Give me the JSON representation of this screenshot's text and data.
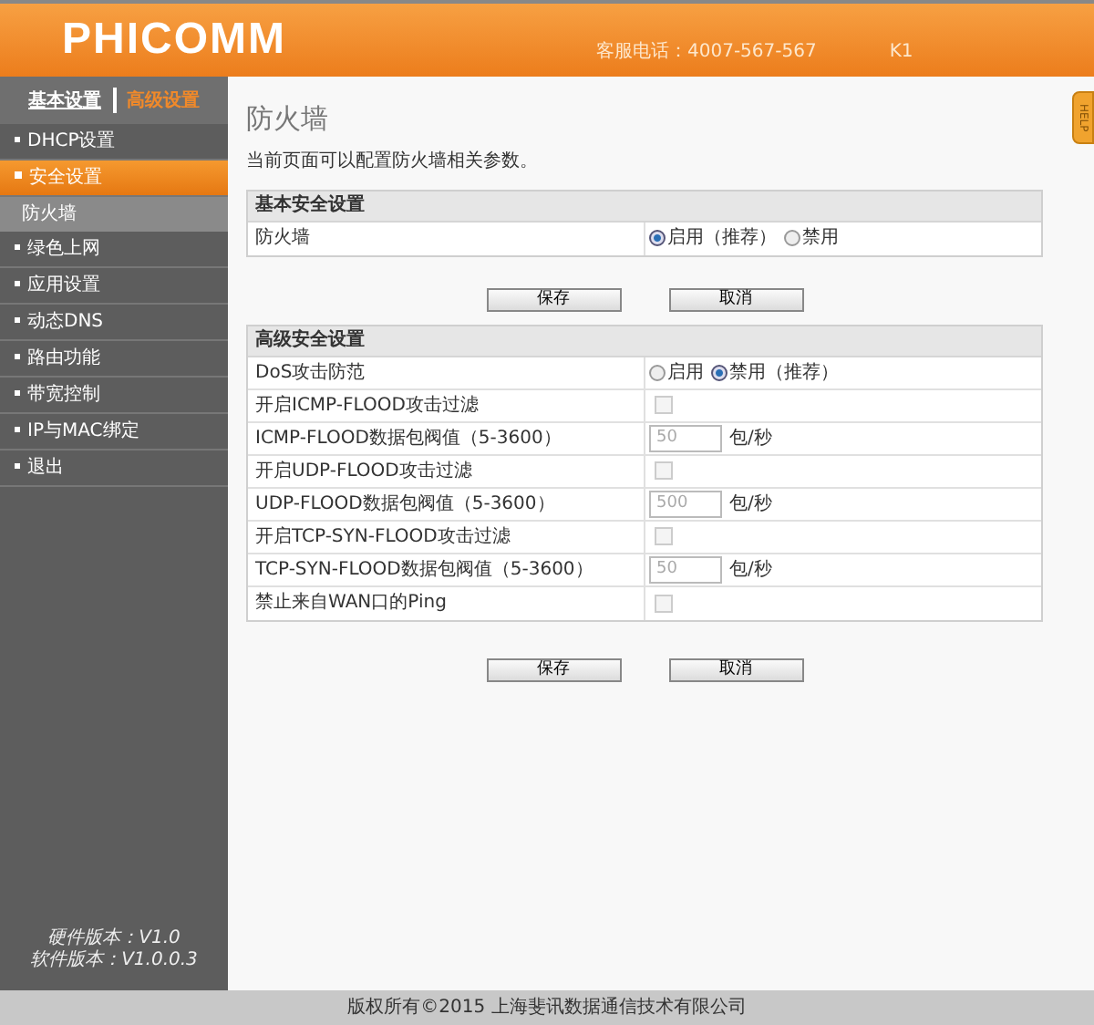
{
  "header": {
    "logo": "PHICOMM",
    "hotline": "客服电话：4007-567-567",
    "model": "K1"
  },
  "nav_tabs": [
    {
      "label": "基本设置",
      "selected": false
    },
    {
      "label": "高级设置",
      "selected": true
    }
  ],
  "sidebar": {
    "items": [
      {
        "label": "DHCP设置",
        "selected": false
      },
      {
        "label": "安全设置",
        "selected": true,
        "children": [
          {
            "label": "防火墙",
            "selected": true
          }
        ]
      },
      {
        "label": "绿色上网",
        "selected": false
      },
      {
        "label": "应用设置",
        "selected": false
      },
      {
        "label": "动态DNS",
        "selected": false
      },
      {
        "label": "路由功能",
        "selected": false
      },
      {
        "label": "带宽控制",
        "selected": false
      },
      {
        "label": "IP与MAC绑定",
        "selected": false
      },
      {
        "label": "退出",
        "selected": false
      }
    ],
    "versions": [
      "硬件版本：V1.0",
      "软件版本：V1.0.0.3"
    ]
  },
  "help": "HELP",
  "page": {
    "title": "防火墙",
    "description": "当前页面可以配置防火墙相关参数。"
  },
  "sections": [
    {
      "title": "基本安全设置",
      "rows": [
        {
          "kind": "radio",
          "label": "防火墙",
          "options": [
            {
              "label": "启用（推荐）",
              "selected": true
            },
            {
              "label": "禁用",
              "selected": false
            }
          ]
        }
      ],
      "buttons": [
        "保存",
        "取消"
      ]
    },
    {
      "title": "高级安全设置",
      "rows": [
        {
          "kind": "radio",
          "label": "DoS攻击防范",
          "options": [
            {
              "label": "启用",
              "selected": false
            },
            {
              "label": "禁用（推荐）",
              "selected": true
            }
          ]
        },
        {
          "kind": "checkbox",
          "label": "开启ICMP-FLOOD攻击过滤",
          "checked": false,
          "disabled": true
        },
        {
          "kind": "number",
          "label": "ICMP-FLOOD数据包阀值（5-3600）",
          "value": "50",
          "unit": "包/秒",
          "disabled": true
        },
        {
          "kind": "checkbox",
          "label": "开启UDP-FLOOD攻击过滤",
          "checked": false,
          "disabled": true
        },
        {
          "kind": "number",
          "label": "UDP-FLOOD数据包阀值（5-3600）",
          "value": "500",
          "unit": "包/秒",
          "disabled": true
        },
        {
          "kind": "checkbox",
          "label": "开启TCP-SYN-FLOOD攻击过滤",
          "checked": false,
          "disabled": true
        },
        {
          "kind": "number",
          "label": "TCP-SYN-FLOOD数据包阀值（5-3600）",
          "value": "50",
          "unit": "包/秒",
          "disabled": true
        },
        {
          "kind": "checkbox",
          "label": "禁止来自WAN口的Ping",
          "checked": false,
          "disabled": true
        }
      ],
      "buttons": [
        "保存",
        "取消"
      ]
    }
  ],
  "footer": "版权所有©2015 上海斐讯数据通信技术有限公司"
}
